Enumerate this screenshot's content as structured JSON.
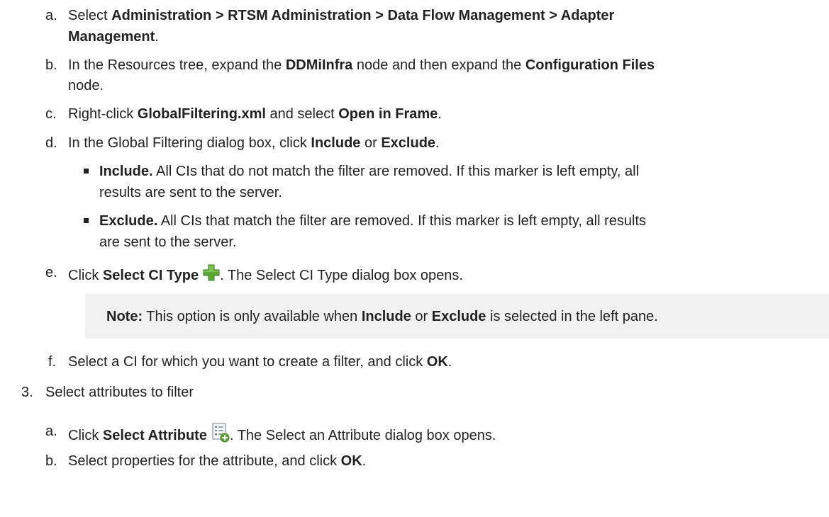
{
  "steps": {
    "a": {
      "marker": "a.",
      "pre": "Select ",
      "path": "Administration > RTSM Administration > Data Flow Management > Adapter",
      "path_cont": "Management",
      "post": "."
    },
    "b": {
      "marker": "b.",
      "pre": "In the Resources tree, expand the ",
      "b1": "DDMiInfra",
      "mid": " node and then expand the ",
      "b2": "Configuration Files",
      "cont": "node."
    },
    "c": {
      "marker": "c.",
      "pre": "Right-click ",
      "b1": "GlobalFiltering.xml",
      "mid": " and select ",
      "b2": "Open in Frame",
      "post": "."
    },
    "d": {
      "marker": "d.",
      "pre": "In the Global Filtering dialog box, click ",
      "b1": "Include",
      "mid": " or ",
      "b2": "Exclude",
      "post": "."
    },
    "bullets": [
      {
        "bold": "Include.",
        "text1": " All CIs that do not match the filter are removed. If this marker is left empty, all",
        "text2": "results are sent to the server."
      },
      {
        "bold": "Exclude.",
        "text1": " All CIs that match the filter are removed. If this marker is left empty, all results",
        "text2": "are sent to the server."
      }
    ],
    "e": {
      "marker": "e.",
      "pre": "Click ",
      "bold": "Select CI Type",
      "icon": "green-plus-icon",
      "post": ". The Select CI Type dialog box opens."
    },
    "note": {
      "label": "Note:",
      "pre": " This option is only available when ",
      "b1": "Include",
      "mid": " or ",
      "b2": "Exclude",
      "post": " is selected in the left pane."
    },
    "f": {
      "marker": "f.",
      "pre": "Select a CI for which you want to create a filter, and click ",
      "bold": "OK",
      "post": "."
    },
    "step3": {
      "marker": "3.",
      "text": "Select attributes to filter"
    },
    "a2": {
      "marker": "a.",
      "pre": "Click ",
      "bold": "Select Attribute",
      "icon": "select-attribute-icon",
      "post": ". The Select an Attribute dialog box opens."
    },
    "b2": {
      "marker": "b.",
      "pre": "Select properties for the attribute, and click ",
      "bold": "OK",
      "post": "."
    }
  }
}
